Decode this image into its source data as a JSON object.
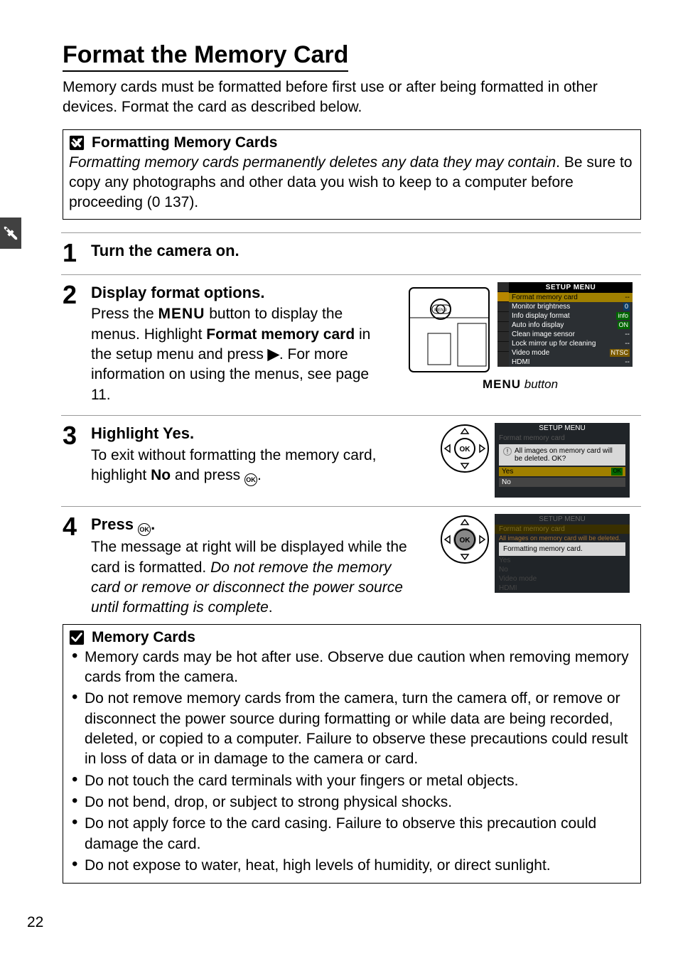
{
  "page_number": "22",
  "title": "Format the Memory Card",
  "lead": "Memory cards must be formatted before first use or after being formatted in other devices.  Format the card as described below.",
  "note1": {
    "title": "Formatting Memory Cards",
    "body_prefix_italic": "Formatting memory cards permanently deletes any data they may contain",
    "body_rest": ".  Be sure to copy any photographs and other data you wish to keep to a computer before proceeding (",
    "page_ref": "0 137",
    "body_suffix": ")."
  },
  "steps": {
    "s1": {
      "num": "1",
      "head": "Turn the camera on."
    },
    "s2": {
      "num": "2",
      "head": "Display format options.",
      "body_prefix": "Press the ",
      "menu_glyph": "MENU",
      "body_mid1": " button to display the menus.  Highlight ",
      "bold1": "Format memory card",
      "body_mid2": " in the setup menu and press ",
      "right_glyph": "▶",
      "body_suffix": ".  For more information on using the menus, see page 11.",
      "caption_prefix": "MENU",
      "caption_suffix": " button"
    },
    "s3": {
      "num": "3",
      "head_prefix": "Highlight ",
      "head_bold": "Yes",
      "head_suffix": ".",
      "body_prefix": "To exit without formatting the memory card, highlight ",
      "bold1": "No",
      "body_mid": " and press ",
      "ok_glyph": "OK",
      "body_suffix": "."
    },
    "s4": {
      "num": "4",
      "head_prefix": "Press ",
      "ok_glyph": "OK",
      "head_suffix": ".",
      "body_prefix": "The message at right will be displayed while the card is formatted.  ",
      "italic": "Do not remove the memory card or remove or disconnect the power source until formatting is complete",
      "body_suffix": "."
    }
  },
  "note2": {
    "title": "Memory Cards",
    "bullets": [
      "Memory cards may be hot after use.  Observe due caution when removing memory cards from the camera.",
      "Do not remove memory cards from the camera, turn the camera off, or remove or disconnect the power source during formatting or while data are being recorded, deleted, or copied to a computer.  Failure to observe these precautions could result in loss of data or in damage to the camera or card.",
      "Do not touch the card terminals with your fingers or metal objects.",
      "Do not bend, drop, or subject to strong physical shocks.",
      "Do not apply force to the card casing.  Failure to observe this precaution could damage the card.",
      "Do not expose to water, heat, high levels of humidity, or direct sunlight."
    ]
  },
  "sim_setup": {
    "title": "SETUP MENU",
    "items": [
      {
        "label": "Format memory card",
        "value": "--",
        "hl": true
      },
      {
        "label": "Monitor brightness",
        "value": "0"
      },
      {
        "label": "Info display format",
        "value": "info"
      },
      {
        "label": "Auto info display",
        "value": "ON"
      },
      {
        "label": "Clean image sensor",
        "value": "--"
      },
      {
        "label": "Lock mirror up for cleaning",
        "value": "--"
      },
      {
        "label": "Video mode",
        "value": "NTSC"
      },
      {
        "label": "HDMI",
        "value": "--"
      }
    ]
  },
  "sim_confirm": {
    "title": "SETUP MENU",
    "crumb": "Format memory card",
    "msg": "All images on memory card will be deleted. OK?",
    "yes": "Yes",
    "no": "No",
    "ok": "OK"
  },
  "sim_progress": {
    "title": "SETUP MENU",
    "crumb": "Format memory card",
    "faded_msg": "All images on memory card will be deleted.",
    "msg": "Formatting memory card.",
    "yes": "Yes",
    "no": "No",
    "video": "Video mode",
    "hdmi": "HDMI"
  }
}
